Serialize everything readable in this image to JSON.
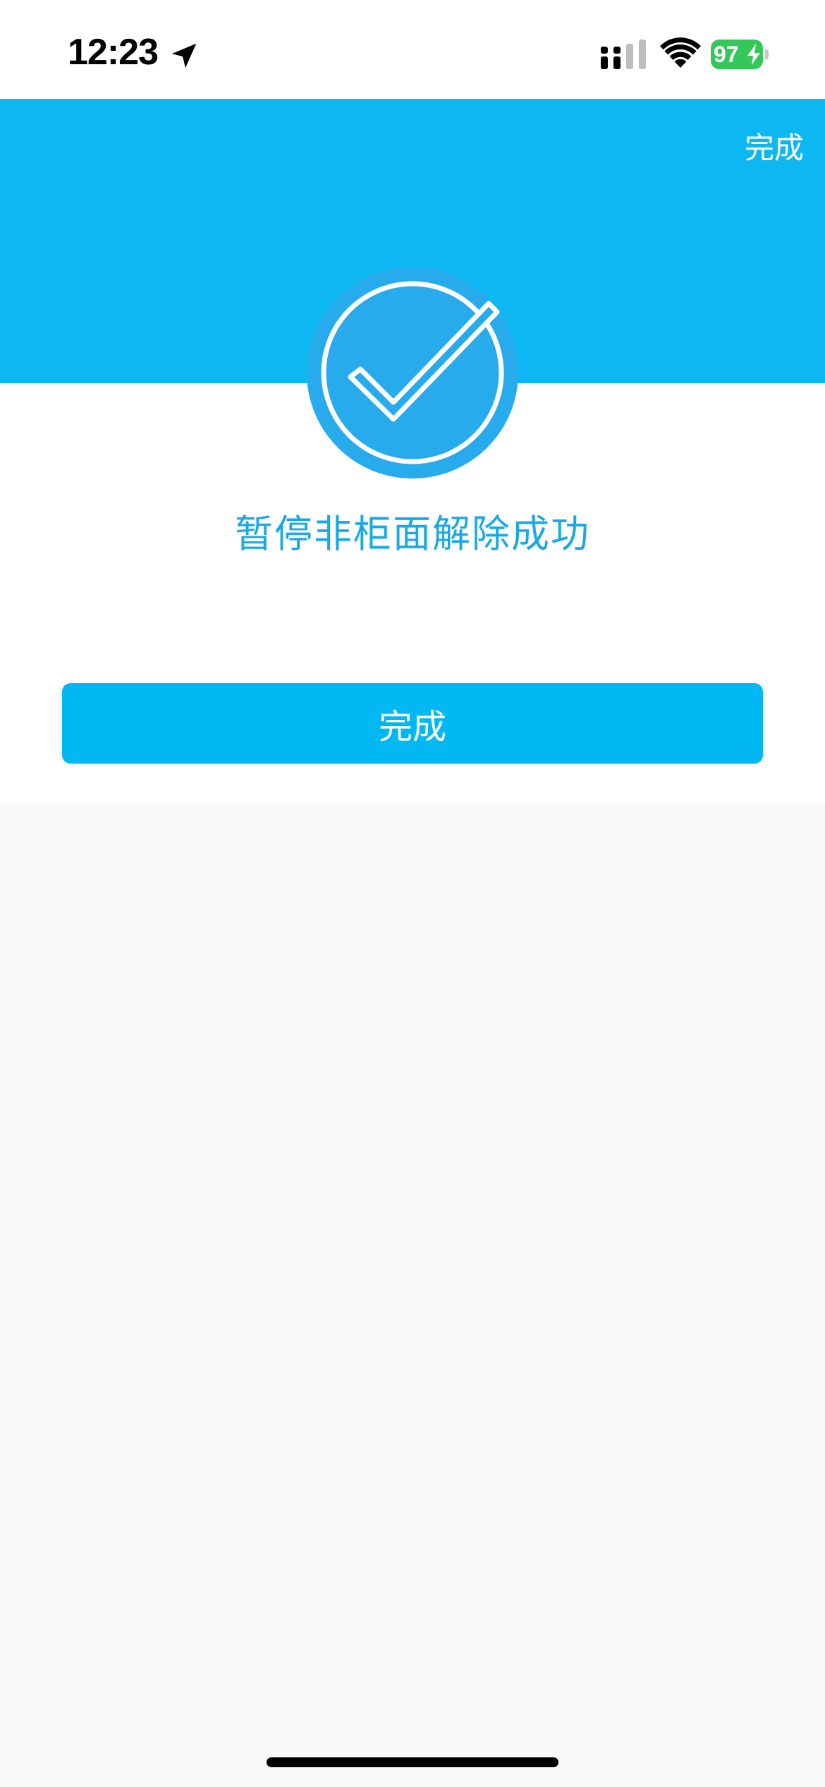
{
  "status_bar": {
    "time": "12:23",
    "battery_level": "97",
    "icons": [
      "location-arrow-icon",
      "cellular-signal-icon",
      "wifi-icon",
      "battery-charging-icon"
    ]
  },
  "header": {
    "done_label": "完成"
  },
  "main": {
    "success_icon": "check-circle-icon",
    "message": "暂停非柜面解除成功",
    "done_button_label": "完成"
  },
  "colors": {
    "header_bg": "#0cb7f2",
    "icon_fill": "#27abec",
    "message_text": "#1aa9e6",
    "button_bg": "#02b8f4",
    "page_bg": "#f9f9f9",
    "battery_green": "#34c759"
  }
}
